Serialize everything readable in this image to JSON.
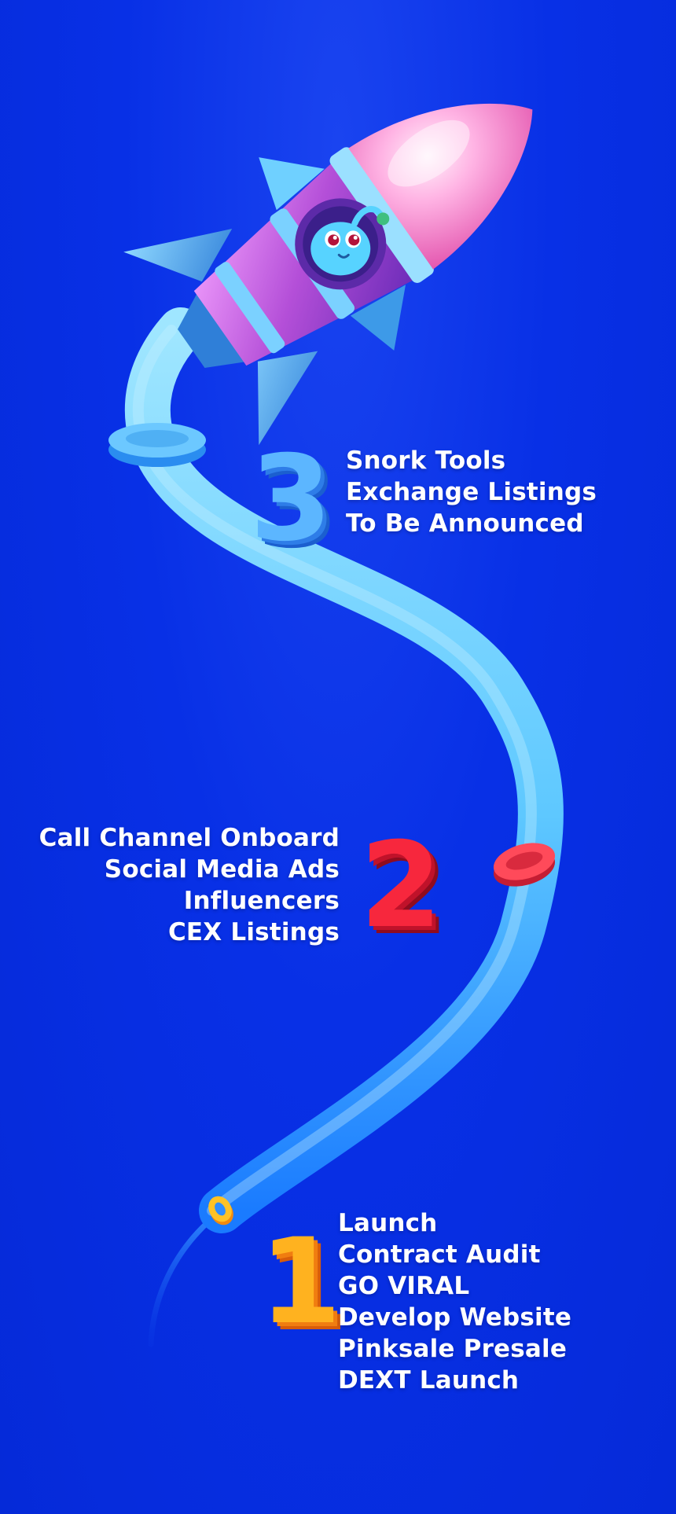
{
  "roadmap": {
    "phases": [
      {
        "number": "1",
        "items": [
          "Launch",
          "Contract Audit",
          "GO VIRAL",
          "Develop Website",
          "Pinksale Presale",
          "DEXT Launch"
        ]
      },
      {
        "number": "2",
        "items": [
          "Call Channel Onboard",
          "Social Media Ads",
          "Influencers",
          "CEX Listings"
        ]
      },
      {
        "number": "3",
        "items": [
          "Snork Tools",
          "Exchange Listings",
          "To Be Announced"
        ]
      }
    ]
  },
  "colors": {
    "background": "#0a2fe0",
    "trail": "#7ad3ff",
    "phase_1": "#ffb21f",
    "phase_2": "#f7273d",
    "phase_3": "#5cb6ff",
    "rocket_body": "#c45fe0",
    "rocket_nose": "#ff8fd0"
  },
  "icons": {
    "rocket": "rocket-with-mascot-icon",
    "mascot": "blue-snork-mascot-icon"
  }
}
